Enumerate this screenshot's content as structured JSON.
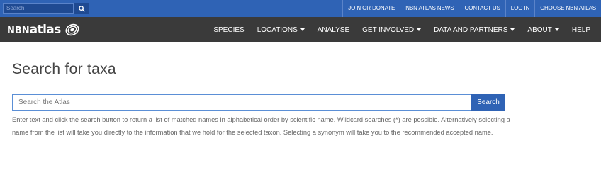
{
  "topbar": {
    "search_placeholder": "Search",
    "search_icon": "search-icon",
    "links": [
      "JOIN OR DONATE",
      "NBN ATLAS NEWS",
      "CONTACT US",
      "LOG IN",
      "CHOOSE NBN ATLAS"
    ]
  },
  "colors": {
    "topbar_bg": "#2f63b5",
    "navbar_bg": "#3a3a3a",
    "search_button_bg": "#2f63b5"
  },
  "navbar": {
    "logo_prefix": "NBN",
    "logo_text": "atlas",
    "logo_icon": "fingerprint-logo-icon",
    "items": [
      {
        "label": "SPECIES",
        "dropdown": false
      },
      {
        "label": "LOCATIONS",
        "dropdown": true
      },
      {
        "label": "ANALYSE",
        "dropdown": false
      },
      {
        "label": "GET INVOLVED",
        "dropdown": true
      },
      {
        "label": "DATA AND PARTNERS",
        "dropdown": true
      },
      {
        "label": "ABOUT",
        "dropdown": true
      },
      {
        "label": "HELP",
        "dropdown": false
      }
    ]
  },
  "main": {
    "title": "Search for taxa",
    "search_placeholder": "Search the Atlas",
    "search_button": "Search",
    "help_text": "Enter text and click the search button to return a list of matched names in alphabetical order by scientific name. Wildcard searches (*) are possible. Alternatively selecting a name from the list will take you directly to the information that we hold for the selected taxon. Selecting a synonym will take you to the recommended accepted name."
  }
}
